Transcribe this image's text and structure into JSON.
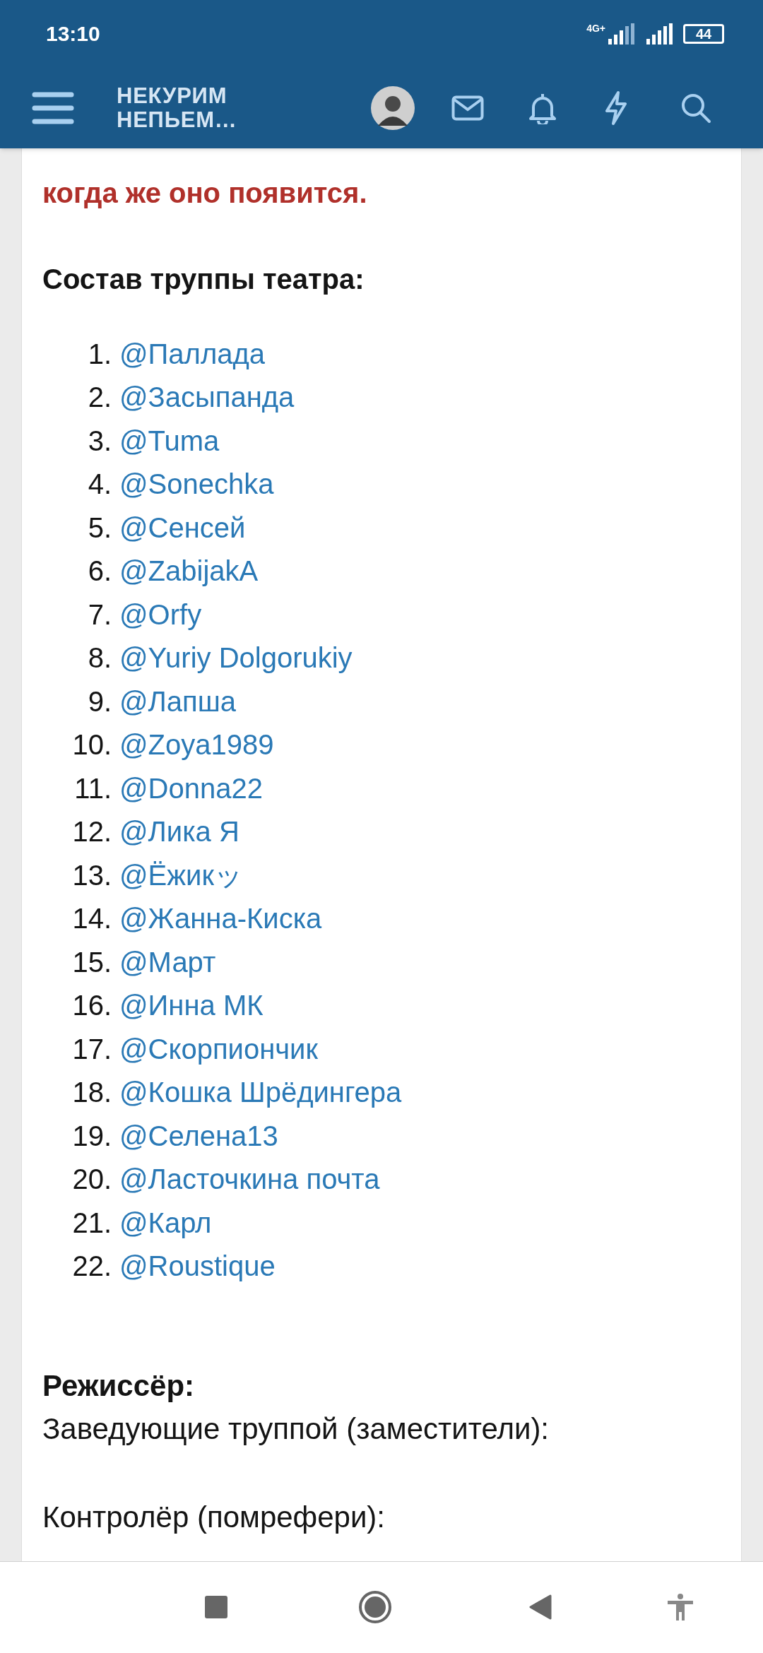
{
  "status_bar": {
    "time": "13:10",
    "network": "4G+",
    "battery": "44"
  },
  "header": {
    "site_title": "НЕКУРИМ НЕПЬЕМ…"
  },
  "post": {
    "highlighted_lines": [
      "когда же оно появится."
    ],
    "cast_heading": "Состав труппы театра:",
    "cast": [
      {
        "number": "1.",
        "name": "@Паллада"
      },
      {
        "number": "2.",
        "name": "@Засыпанда"
      },
      {
        "number": "3.",
        "name": "@Tuma"
      },
      {
        "number": "4.",
        "name": "@Sonechka"
      },
      {
        "number": "5.",
        "name": "@Сенсей"
      },
      {
        "number": "6.",
        "name": "@ZabijakA"
      },
      {
        "number": "7.",
        "name": "@Orfy"
      },
      {
        "number": "8.",
        "name": "@Yuriy Dolgorukiy"
      },
      {
        "number": "9.",
        "name": "@Лапша"
      },
      {
        "number": "10.",
        "name": "@Zoya1989"
      },
      {
        "number": "11.",
        "name": "@Donna22"
      },
      {
        "number": "12.",
        "name": "@Лика Я"
      },
      {
        "number": "13.",
        "name": "@Ёжикッ"
      },
      {
        "number": "14.",
        "name": "@Жанна-Киска"
      },
      {
        "number": "15.",
        "name": "@Март"
      },
      {
        "number": "16.",
        "name": "@Инна МК"
      },
      {
        "number": "17.",
        "name": "@Скорпиончик"
      },
      {
        "number": "18.",
        "name": "@Кошка Шрёдингера"
      },
      {
        "number": "19.",
        "name": "@Селена13"
      },
      {
        "number": "20.",
        "name": "@Ласточкина почта"
      },
      {
        "number": "21.",
        "name": "@Карл"
      },
      {
        "number": "22.",
        "name": "@Roustique"
      }
    ],
    "roles": [
      {
        "text": "Режиссёр:",
        "bold": true
      },
      {
        "text": "Заведующие труппой (заместители):",
        "bold": false
      },
      {
        "text": "Контролёр (помрефери):",
        "bold": false
      }
    ]
  }
}
